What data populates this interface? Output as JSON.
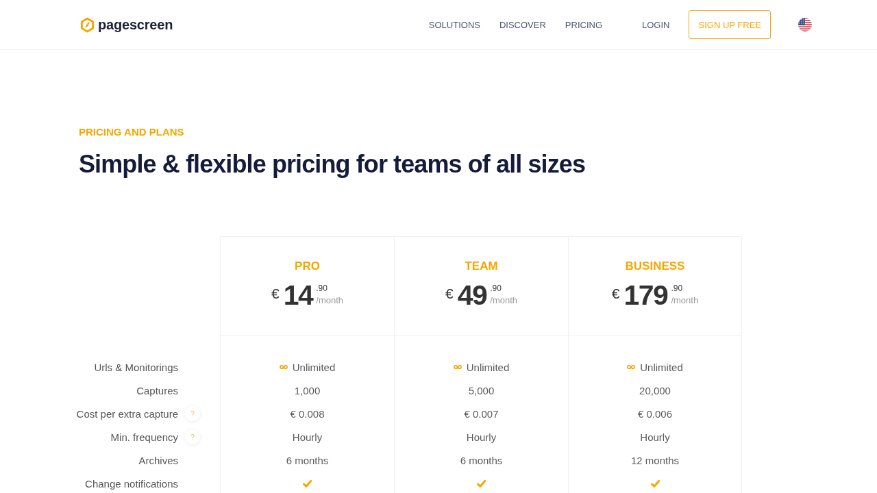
{
  "header": {
    "logo_text": "pagescreen",
    "nav": [
      "SOLUTIONS",
      "DISCOVER",
      "PRICING"
    ],
    "login": "LOGIN",
    "signup": "SIGN UP FREE"
  },
  "hero": {
    "eyebrow": "PRICING AND PLANS",
    "title": "Simple & flexible pricing for teams of all sizes"
  },
  "pricing": {
    "features": [
      {
        "label": "Urls & Monitorings"
      },
      {
        "label": "Captures"
      },
      {
        "label": "Cost per extra capture",
        "hint": "?"
      },
      {
        "label": "Min. frequency",
        "hint": "?"
      },
      {
        "label": "Archives"
      },
      {
        "label": "Change notifications"
      }
    ],
    "plans": [
      {
        "name": "PRO",
        "currency": "€",
        "amount": "14",
        "cents": ".90",
        "period": "/month",
        "values": [
          {
            "kind": "unlimited",
            "text": "Unlimited"
          },
          {
            "kind": "text",
            "text": "1,000"
          },
          {
            "kind": "text",
            "text": "€ 0.008"
          },
          {
            "kind": "text",
            "text": "Hourly"
          },
          {
            "kind": "text",
            "text": "6 months"
          },
          {
            "kind": "check"
          }
        ]
      },
      {
        "name": "TEAM",
        "currency": "€",
        "amount": "49",
        "cents": ".90",
        "period": "/month",
        "values": [
          {
            "kind": "unlimited",
            "text": "Unlimited"
          },
          {
            "kind": "text",
            "text": "5,000"
          },
          {
            "kind": "text",
            "text": "€ 0.007"
          },
          {
            "kind": "text",
            "text": "Hourly"
          },
          {
            "kind": "text",
            "text": "6 months"
          },
          {
            "kind": "check"
          }
        ]
      },
      {
        "name": "BUSINESS",
        "currency": "€",
        "amount": "179",
        "cents": ".90",
        "period": "/month",
        "values": [
          {
            "kind": "unlimited",
            "text": "Unlimited"
          },
          {
            "kind": "text",
            "text": "20,000"
          },
          {
            "kind": "text",
            "text": "€ 0.006"
          },
          {
            "kind": "text",
            "text": "Hourly"
          },
          {
            "kind": "text",
            "text": "12 months"
          },
          {
            "kind": "check"
          }
        ]
      }
    ]
  }
}
